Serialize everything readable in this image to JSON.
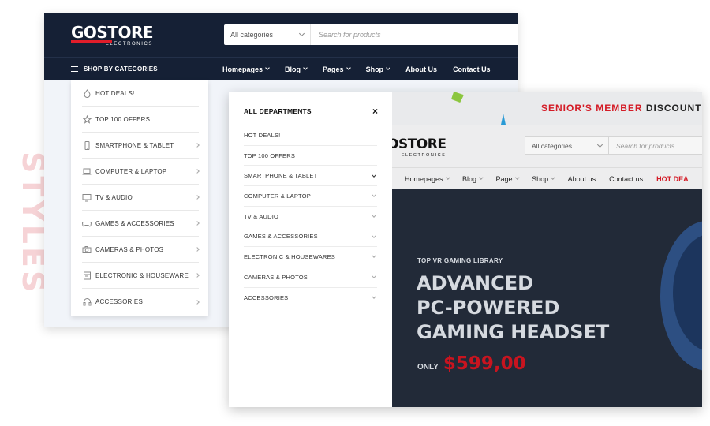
{
  "side_label": "STYLES",
  "window1": {
    "logo": {
      "main": "GOSTORE",
      "sub": "ELECTRONICS"
    },
    "search": {
      "category": "All categories",
      "placeholder": "Search for products"
    },
    "shop_by_categories": "SHOP BY CATEGORIES",
    "nav": [
      {
        "label": "Homepages",
        "dropdown": true
      },
      {
        "label": "Blog",
        "dropdown": true
      },
      {
        "label": "Pages",
        "dropdown": true
      },
      {
        "label": "Shop",
        "dropdown": true
      },
      {
        "label": "About Us",
        "dropdown": false
      },
      {
        "label": "Contact Us",
        "dropdown": false
      }
    ],
    "menu": [
      {
        "label": "HOT DEALS!",
        "icon": "flame-icon",
        "arrow": false
      },
      {
        "label": "TOP 100 OFFERS",
        "icon": "star-icon",
        "arrow": false
      },
      {
        "label": "SMARTPHONE & TABLET",
        "icon": "smartphone-icon",
        "arrow": true
      },
      {
        "label": "COMPUTER & LAPTOP",
        "icon": "laptop-icon",
        "arrow": true
      },
      {
        "label": "TV & AUDIO",
        "icon": "tv-icon",
        "arrow": true
      },
      {
        "label": "GAMES & ACCESSORIES",
        "icon": "gamepad-icon",
        "arrow": true
      },
      {
        "label": "CAMERAS & PHOTOS",
        "icon": "camera-icon",
        "arrow": true
      },
      {
        "label": "ELECTRONIC & HOUSEWARE",
        "icon": "appliance-icon",
        "arrow": true
      },
      {
        "label": "ACCESSORIES",
        "icon": "headphones-icon",
        "arrow": true
      }
    ]
  },
  "window2": {
    "departments": {
      "title": "ALL DEPARTMENTS",
      "close": "×",
      "items": [
        {
          "label": "HOT DEALS!",
          "arrow": false
        },
        {
          "label": "TOP 100 OFFERS",
          "arrow": false
        },
        {
          "label": "SMARTPHONE & TABLET",
          "arrow": true,
          "active": true
        },
        {
          "label": "COMPUTER & LAPTOP",
          "arrow": true
        },
        {
          "label": "TV & AUDIO",
          "arrow": true
        },
        {
          "label": "GAMES & ACCESSORIES",
          "arrow": true
        },
        {
          "label": "ELECTRONIC & HOUSEWARES",
          "arrow": true
        },
        {
          "label": "CAMERAS & PHOTOS",
          "arrow": true
        },
        {
          "label": "ACCESSORIES",
          "arrow": true
        }
      ]
    },
    "promo": {
      "highlight": "SENIOR'S MEMBER",
      "rest": "DISCOUNT D"
    },
    "logo": {
      "main": "OSTORE",
      "sub": "ELECTRONICS"
    },
    "search": {
      "category": "All categories",
      "placeholder": "Search for products"
    },
    "nav": [
      {
        "label": "Homepages",
        "dropdown": true
      },
      {
        "label": "Blog",
        "dropdown": true
      },
      {
        "label": "Page",
        "dropdown": true
      },
      {
        "label": "Shop",
        "dropdown": true
      },
      {
        "label": "About us",
        "dropdown": false
      },
      {
        "label": "Contact us",
        "dropdown": false
      },
      {
        "label": "HOT DEA",
        "dropdown": false,
        "hot": true
      }
    ],
    "hero": {
      "subtitle": "TOP VR GAMING LIBRARY",
      "title_lines": [
        "ADVANCED",
        "PC-POWERED",
        "GAMING HEADSET"
      ],
      "only": "ONLY",
      "price": "$599,00"
    }
  },
  "colors": {
    "navy": "#152035",
    "accent_red": "#e11d2a",
    "price_red": "#c8141f",
    "label_pink": "#f6d3d6"
  }
}
